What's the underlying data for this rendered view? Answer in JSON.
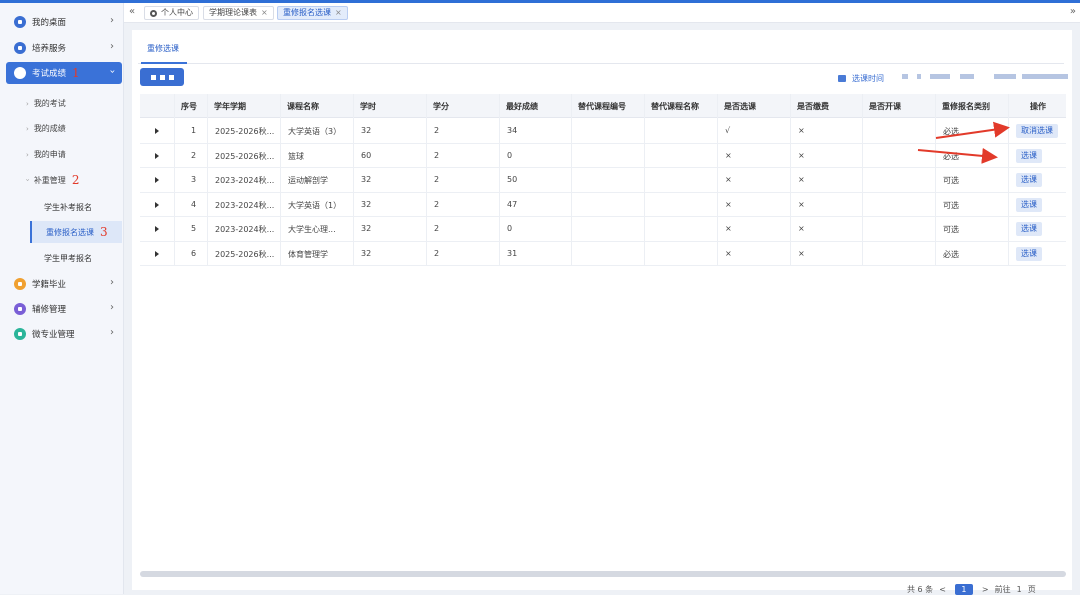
{
  "sidebar": {
    "items": [
      {
        "label": "我的桌面",
        "icon": "desktop-icon",
        "color": "#3a6ed2"
      },
      {
        "label": "培养服务",
        "icon": "training-icon",
        "color": "#3a6ed2"
      },
      {
        "label": "考试成绩",
        "icon": "exam-icon",
        "color": "#ffffff",
        "active": true,
        "mark": "1"
      },
      {
        "label": "学籍毕业",
        "icon": "graduation-icon",
        "color": "#f0a030"
      },
      {
        "label": "辅修管理",
        "icon": "minor-icon",
        "color": "#7a5fd6"
      },
      {
        "label": "微专业管理",
        "icon": "micro-major-icon",
        "color": "#2bb59a"
      }
    ],
    "sub_items": [
      "我的考试",
      "我的成绩",
      "我的申请"
    ],
    "group": {
      "label": "补重管理",
      "mark": "2"
    },
    "group_items": [
      {
        "label": "学生补考报名"
      },
      {
        "label": "重修报名选课",
        "active": true,
        "mark": "3"
      },
      {
        "label": "学生甲考报名"
      }
    ]
  },
  "tabs": [
    {
      "label": "个人中心",
      "icon": "home-icon"
    },
    {
      "label": "学期理论课表",
      "close": "×"
    },
    {
      "label": "重修报名选课",
      "close": "×",
      "active": true
    }
  ],
  "tabbar": {
    "collapse": "«",
    "expand": "»"
  },
  "subtab": "重修选课",
  "select_time_label": "选课时间",
  "table": {
    "headers": [
      "序号",
      "学年学期",
      "课程名称",
      "学时",
      "学分",
      "最好成绩",
      "替代课程编号",
      "替代课程名称",
      "是否选课",
      "是否缴费",
      "是否开课",
      "重修报名类别",
      "操作"
    ],
    "rows": [
      {
        "no": "1",
        "term": "2025-2026秋...",
        "course": "大学英语（3）",
        "hours": "32",
        "credit": "2",
        "best": "34",
        "alt_code": "",
        "alt_name": "",
        "selected": "√",
        "paid": "×",
        "open": "",
        "category": "必选",
        "action": "取消选课"
      },
      {
        "no": "2",
        "term": "2025-2026秋...",
        "course": "篮球",
        "hours": "60",
        "credit": "2",
        "best": "0",
        "alt_code": "",
        "alt_name": "",
        "selected": "×",
        "paid": "×",
        "open": "",
        "category": "必选",
        "action": "选课"
      },
      {
        "no": "3",
        "term": "2023-2024秋...",
        "course": "运动解剖学",
        "hours": "32",
        "credit": "2",
        "best": "50",
        "alt_code": "",
        "alt_name": "",
        "selected": "×",
        "paid": "×",
        "open": "",
        "category": "可选",
        "action": "选课"
      },
      {
        "no": "4",
        "term": "2023-2024秋...",
        "course": "大学英语（1）",
        "hours": "32",
        "credit": "2",
        "best": "47",
        "alt_code": "",
        "alt_name": "",
        "selected": "×",
        "paid": "×",
        "open": "",
        "category": "可选",
        "action": "选课"
      },
      {
        "no": "5",
        "term": "2023-2024秋...",
        "course": "大学生心理...",
        "hours": "32",
        "credit": "2",
        "best": "0",
        "alt_code": "",
        "alt_name": "",
        "selected": "×",
        "paid": "×",
        "open": "",
        "category": "可选",
        "action": "选课"
      },
      {
        "no": "6",
        "term": "2025-2026秋...",
        "course": "体育管理学",
        "hours": "32",
        "credit": "2",
        "best": "31",
        "alt_code": "",
        "alt_name": "",
        "selected": "×",
        "paid": "×",
        "open": "",
        "category": "必选",
        "action": "选课"
      }
    ]
  },
  "pager": {
    "total": "共 6 条",
    "prev": "<",
    "page": "1",
    "next": ">",
    "goto": "前往",
    "page_input": "1",
    "suffix": "页"
  },
  "colors": {
    "accent": "#3a6ed2",
    "annotation": "#e23a2a"
  }
}
